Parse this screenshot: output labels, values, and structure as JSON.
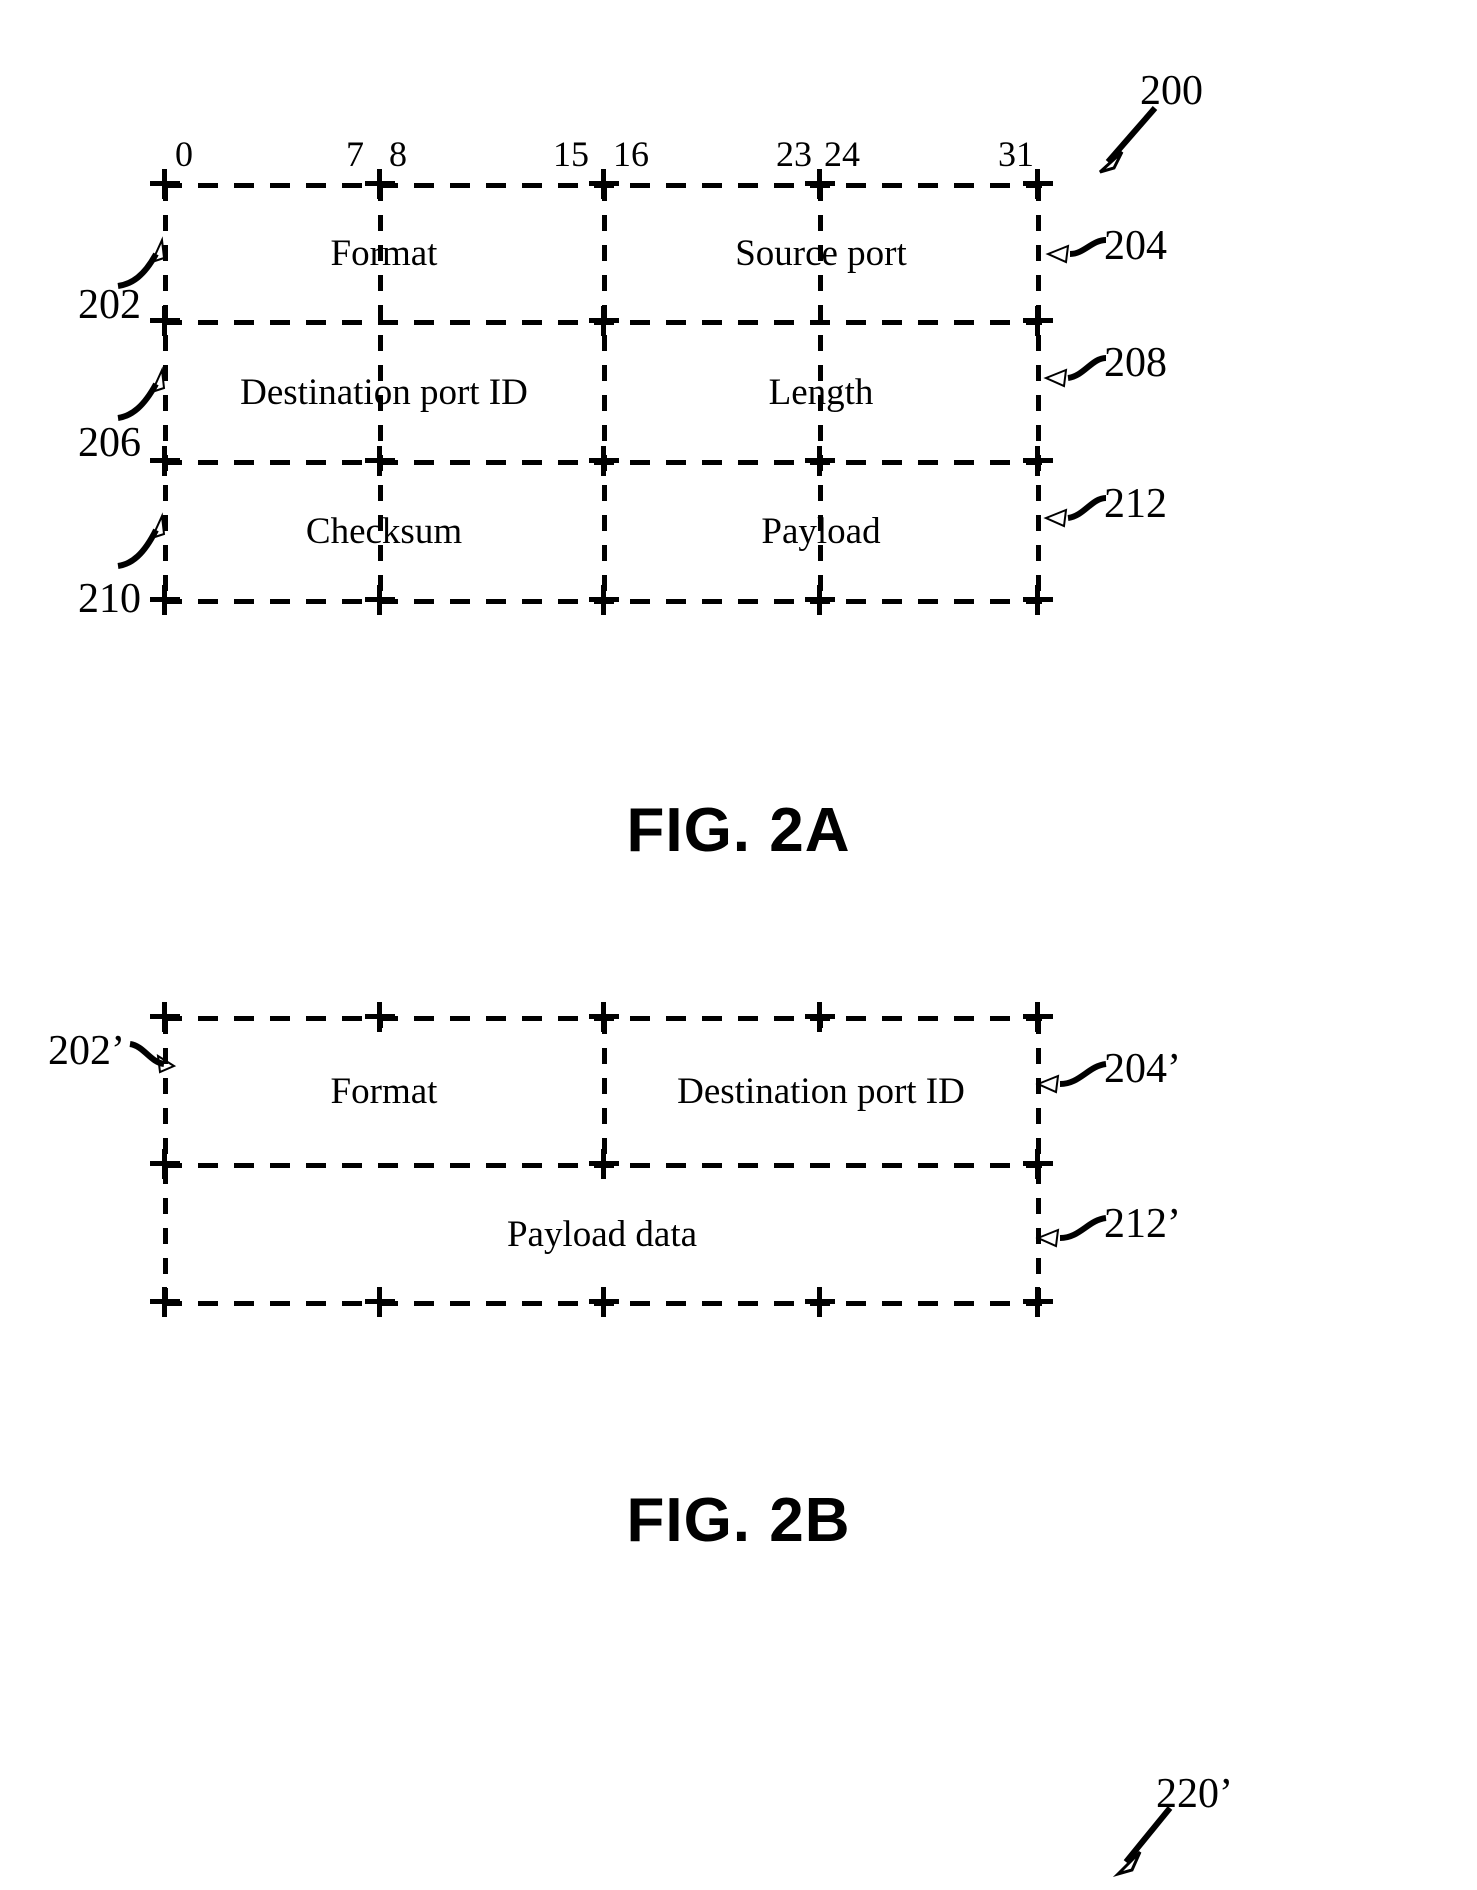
{
  "document": {
    "type": "patent-figure-sheet",
    "figures": [
      "FIG. 2A",
      "FIG. 2B"
    ]
  },
  "fig2a": {
    "caption": "FIG. 2A",
    "overall_ref": "200",
    "bit_scale": {
      "label_0": "0",
      "label_7": "7",
      "label_8": "8",
      "label_15": "15",
      "label_16": "16",
      "label_23": "23",
      "label_24": "24",
      "label_31": "31"
    },
    "rows": [
      {
        "left": {
          "label": "Format",
          "ref": "202"
        },
        "right": {
          "label": "Source port",
          "ref": "204"
        }
      },
      {
        "left": {
          "label": "Destination port ID",
          "ref": "206"
        },
        "right": {
          "label": "Length",
          "ref": "208"
        }
      },
      {
        "left": {
          "label": "Checksum",
          "ref": "210"
        },
        "right": {
          "label": "Payload",
          "ref": "212"
        }
      }
    ]
  },
  "fig2b": {
    "caption": "FIG. 2B",
    "overall_ref": "220’",
    "rows": [
      {
        "left": {
          "label": "Format",
          "ref": "202’"
        },
        "right": {
          "label": "Destination port ID",
          "ref": "204’"
        }
      },
      {
        "full": {
          "label": "Payload data",
          "ref": "212’"
        }
      }
    ]
  },
  "colors": {
    "ink": "#000000",
    "paper": "#ffffff"
  }
}
